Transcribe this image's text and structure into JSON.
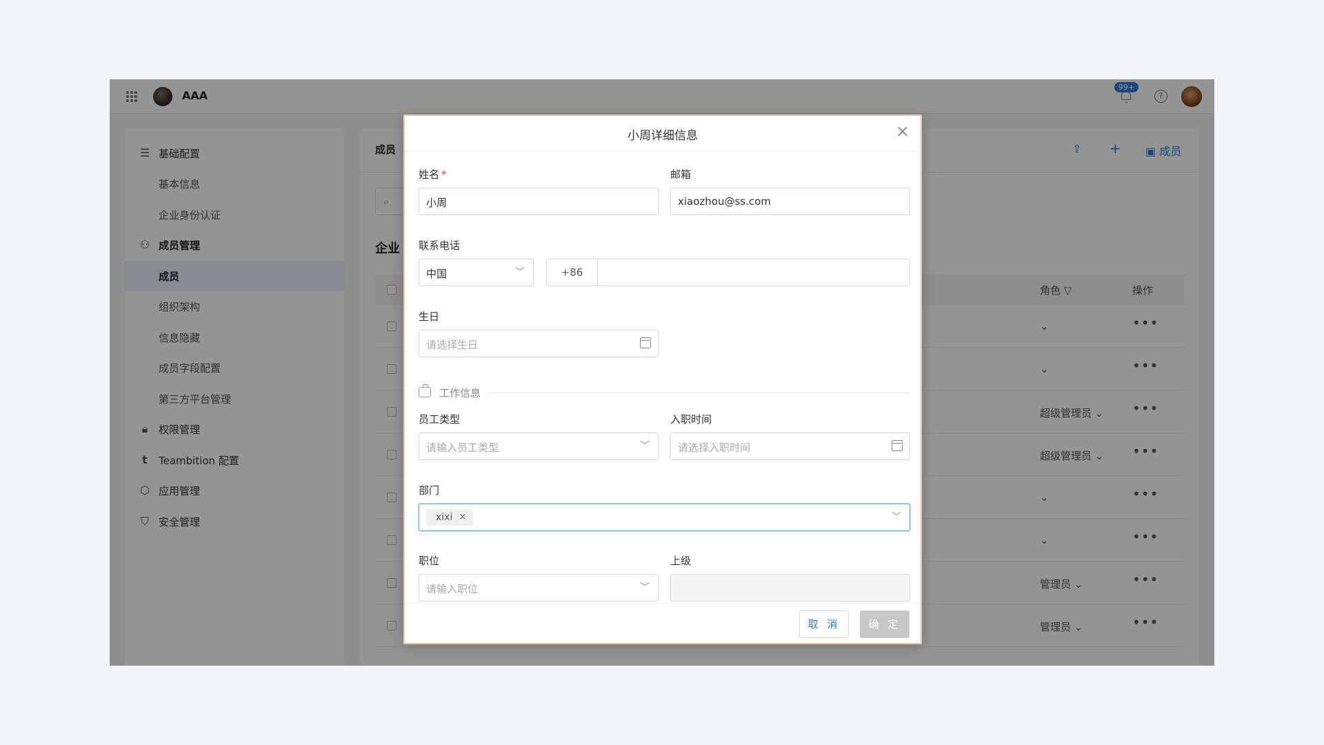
{
  "app": {
    "name": "AAA",
    "notif_count": "99+",
    "help_symbol": "?"
  },
  "sidebar": {
    "items": [
      {
        "label": "基础配置",
        "icon": "sliders-icon"
      },
      {
        "label": "基本信息"
      },
      {
        "label": "企业身份认证"
      },
      {
        "label": "成员管理",
        "icon": "user-icon"
      },
      {
        "label": "成员"
      },
      {
        "label": "组织架构"
      },
      {
        "label": "信息隐藏"
      },
      {
        "label": "成员字段配置"
      },
      {
        "label": "第三方平台管理"
      },
      {
        "label": "权限管理",
        "icon": "lock-icon"
      },
      {
        "label": "Teambition 配置",
        "icon": "teambition-icon"
      },
      {
        "label": "应用管理",
        "icon": "cube-icon"
      },
      {
        "label": "安全管理",
        "icon": "shield-icon"
      }
    ]
  },
  "main": {
    "title": "成员",
    "header_member_label": "成员",
    "section_title": "企业",
    "columns": {
      "role": "角色",
      "ops": "操作"
    },
    "rows": [
      {
        "role": ""
      },
      {
        "role": ""
      },
      {
        "role": "超级管理员"
      },
      {
        "role": "超级管理员"
      },
      {
        "role": ""
      },
      {
        "role": ""
      },
      {
        "role": "管理员"
      },
      {
        "role": "管理员"
      }
    ]
  },
  "modal": {
    "title": "小周详细信息",
    "close": "×",
    "name": {
      "label": "姓名",
      "required_mark": "*",
      "value": "小周"
    },
    "email": {
      "label": "邮箱",
      "value": "xiaozhou@ss.com"
    },
    "phone": {
      "label": "联系电话",
      "country": "中国",
      "code": "+86",
      "value": ""
    },
    "birthday": {
      "label": "生日",
      "placeholder": "请选择生日"
    },
    "work_section": "工作信息",
    "emp_type": {
      "label": "员工类型",
      "placeholder": "请输入员工类型"
    },
    "join_date": {
      "label": "入职时间",
      "placeholder": "请选择入职时间"
    },
    "dept": {
      "label": "部门",
      "tags": [
        "xixi"
      ],
      "tag_remove": "×"
    },
    "position": {
      "label": "职位",
      "placeholder": "请输入职位"
    },
    "superior": {
      "label": "上级",
      "value": ""
    },
    "cancel": "取 消",
    "ok": "确 定"
  },
  "colors": {
    "accent": "#2f7ad6",
    "overlay": "rgba(0,0,0,0.42)",
    "modal_border": "#e9c9a0",
    "required": "#e5484d"
  }
}
